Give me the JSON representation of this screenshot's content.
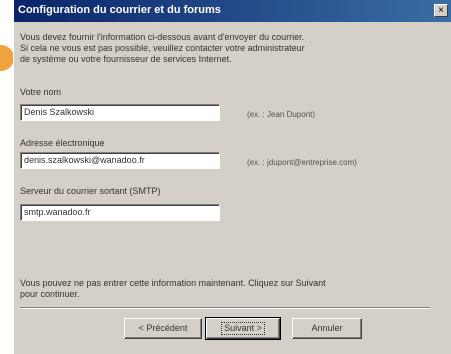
{
  "dialog": {
    "title": "Configuration du courrier et du forums",
    "close_glyph": "×",
    "intro_lines": [
      "Vous devez fournir l'information ci-dessous avant d'envoyer du courrier.",
      "Si cela ne vous est pas possible, veuillez contacter votre administrateur",
      "de système ou votre fournisseur de services Internet."
    ],
    "name": {
      "label": "Votre nom",
      "value": "Denis Szalkowski",
      "hint": "(ex. : Jean Dupont)"
    },
    "email": {
      "label": "Adresse électronique",
      "value": "denis.szalkowski@wanadoo.fr",
      "hint": "(ex. : jdupont@entreprise.com)"
    },
    "smtp": {
      "label": "Serveur du courrier sortant (SMTP)",
      "value": "smtp.wanadoo.fr"
    },
    "bottom_lines": [
      "Vous pouvez ne pas entrer cette information maintenant. Cliquez sur Suivant",
      "pour continuer."
    ],
    "buttons": {
      "back": "< Précédent",
      "next": "Suivant >",
      "cancel": "Annuler"
    }
  },
  "colors": {
    "title_gradient_start": "#0a246a",
    "title_gradient_end": "#3a6ea5",
    "dialog_face": "#d4d0c8",
    "badge": "#f0a23c"
  }
}
